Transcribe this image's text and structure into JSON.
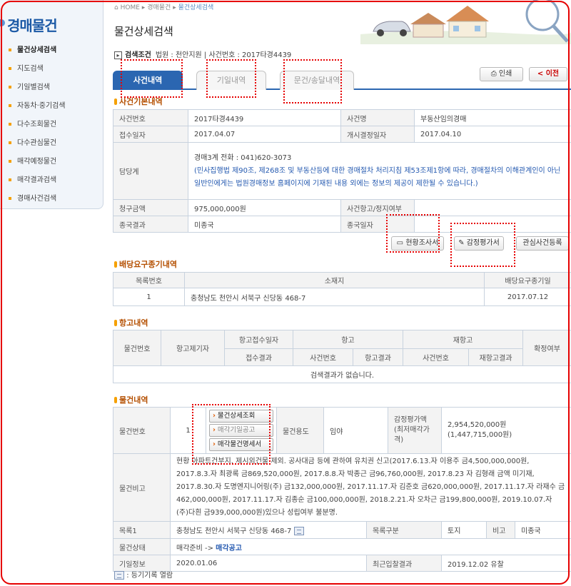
{
  "sidebar": {
    "title": "경매물건",
    "items": [
      {
        "label": "물건상세검색"
      },
      {
        "label": "지도검색"
      },
      {
        "label": "기일별검색"
      },
      {
        "label": "자동차·중기검색"
      },
      {
        "label": "다수조회물건"
      },
      {
        "label": "다수관심물건"
      },
      {
        "label": "매각예정물건"
      },
      {
        "label": "매각결과검색"
      },
      {
        "label": "경매사건검색"
      }
    ]
  },
  "header": {
    "breadcrumb_home": "HOME",
    "breadcrumb_sep1": "▸",
    "breadcrumb_mid": "경매물건",
    "breadcrumb_sep2": "▸",
    "breadcrumb_current": "물건상세검색",
    "page_title": "물건상세검색"
  },
  "search_condition": {
    "label": "검색조건",
    "text": "법원 : 천안지원  |  사건번호 : 2017타경4439"
  },
  "tabs": [
    {
      "label": "사건내역"
    },
    {
      "label": "기일내역"
    },
    {
      "label": "문건/송달내역"
    }
  ],
  "buttons": {
    "print": "인쇄",
    "prev": "< 이전",
    "survey": "현황조사서",
    "appraisal": "감정평가서",
    "interest": "관심사건등록"
  },
  "case_basic": {
    "section_title": "사건기본내역",
    "case_no_label": "사건번호",
    "case_no": "2017타경4439",
    "case_name_label": "사건명",
    "case_name": "부동산임의경매",
    "received_label": "접수일자",
    "received": "2017.04.07",
    "start_label": "개시결정일자",
    "start": "2017.04.10",
    "officer_label": "담당계",
    "officer": "경매3계    전화 : 041)620-3073",
    "officer_note": "(민사집행법 제90조, 제268조 및 부동산등에 대한 경매절차 처리지침 제53조제1항에 따라, 경매절차의 이해관계인이 아닌 일반인에게는 법원경매정보 홈페이지에 기재된 내용 외에는 정보의 제공이 제한될 수 있습니다.)",
    "claim_label": "청구금액",
    "claim": "975,000,000원",
    "appeal_label": "사건항고/정지여부",
    "appeal": "",
    "result_label": "종국결과",
    "result": "미종국",
    "end_label": "종국일자",
    "end": ""
  },
  "dividend": {
    "section_title": "배당요구종기내역",
    "headers": [
      "목록번호",
      "소재지",
      "배당요구종기일"
    ],
    "rows": [
      [
        "1",
        "충청남도 천안시 서북구 신당동 468-7",
        "2017.07.12"
      ]
    ]
  },
  "appeal": {
    "section_title": "항고내역",
    "h_item": "물건번호",
    "h_filer": "항고제기자",
    "h_date": "항고접수일자",
    "h_appeal": "항고",
    "h_reappeal": "재항고",
    "h_final": "확정여부",
    "h_result": "접수결과",
    "h_case1": "사건번호",
    "h_res1": "항고결과",
    "h_case2": "사건번호",
    "h_res2": "재항고결과",
    "empty": "검색결과가 없습니다."
  },
  "item": {
    "section_title": "물건내역",
    "no_label": "물건번호",
    "no": "1",
    "btn_detail": "물건상세조회",
    "btn_notice": "매각기일공고",
    "btn_spec": "매각물건명세서",
    "use_label": "물건용도",
    "use": "임야",
    "appraisal_label": "감정평가액",
    "appraisal_label2": "(최저매각가격)",
    "appraisal": "2,954,520,000원",
    "min_price": "(1,447,715,000원)",
    "memo_label": "물건비고",
    "memo": "현황 아파트건부지. 제시외건물 제외. 공사대금 등에 관하여 유치권 신고(2017.6.13.자 이용주 금4,500,000,000원, 2017.8.3.자 최광록 금869,520,000원, 2017.8.8.자 박종근 금96,760,000원, 2017.8.23 자 김형래 금액 미기재, 2017.8.30.자 도명엔지니어링(주) 금132,000,000원, 2017.11.17.자 김준호 금620,000,000원, 2017.11.17.자 라재수 금462,000,000원, 2017.11.17.자 김종순 금100,000,000원, 2018.2.21.자 오차근 금199,800,000원, 2019.10.07.자 (주)다흰 금939,000,000원)있으나 성립여부 불분명.",
    "list_label": "목록1",
    "list_addr": "충청남도 천안시 서북구 신당동 468-7",
    "list_type_label": "목록구분",
    "list_type": "토지",
    "remark_label": "비고",
    "remark": "미종국",
    "status_label": "물건상태",
    "status_pre": "매각준비 -> ",
    "status": "매각공고",
    "date_label": "기일정보",
    "date": "2020.01.06",
    "bid_label": "최근입찰결과",
    "bid": "2019.12.02 유찰"
  },
  "footer_note": ": 등기기록 열람",
  "colors": {
    "accent": "#2b66b1",
    "highlight": "#e60000",
    "section": "#b44f00"
  }
}
